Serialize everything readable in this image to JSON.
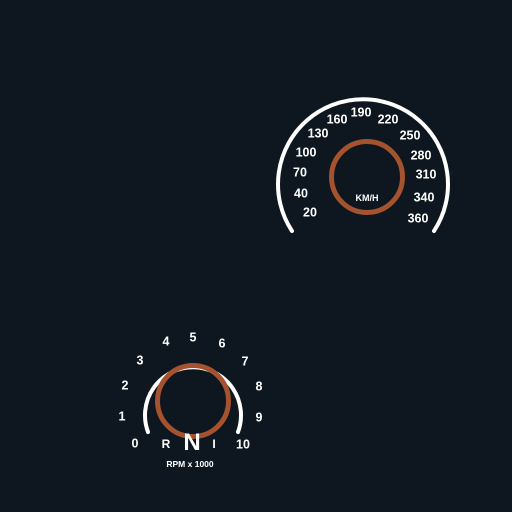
{
  "theme": {
    "background": "#0e1720",
    "arc_color": "#ffffff",
    "inner_ring_color": "#a4532e",
    "text_color": "#ffffff"
  },
  "speedometer": {
    "unit_label": "KM/H",
    "ticks": [
      "20",
      "40",
      "70",
      "100",
      "130",
      "160",
      "190",
      "220",
      "250",
      "280",
      "310",
      "340",
      "360"
    ]
  },
  "tachometer": {
    "unit_label": "RPM x 1000",
    "ticks": [
      "0",
      "1",
      "2",
      "3",
      "4",
      "5",
      "6",
      "7",
      "8",
      "9",
      "10"
    ],
    "gear": {
      "current": "N",
      "left": "R",
      "right": "I"
    }
  }
}
